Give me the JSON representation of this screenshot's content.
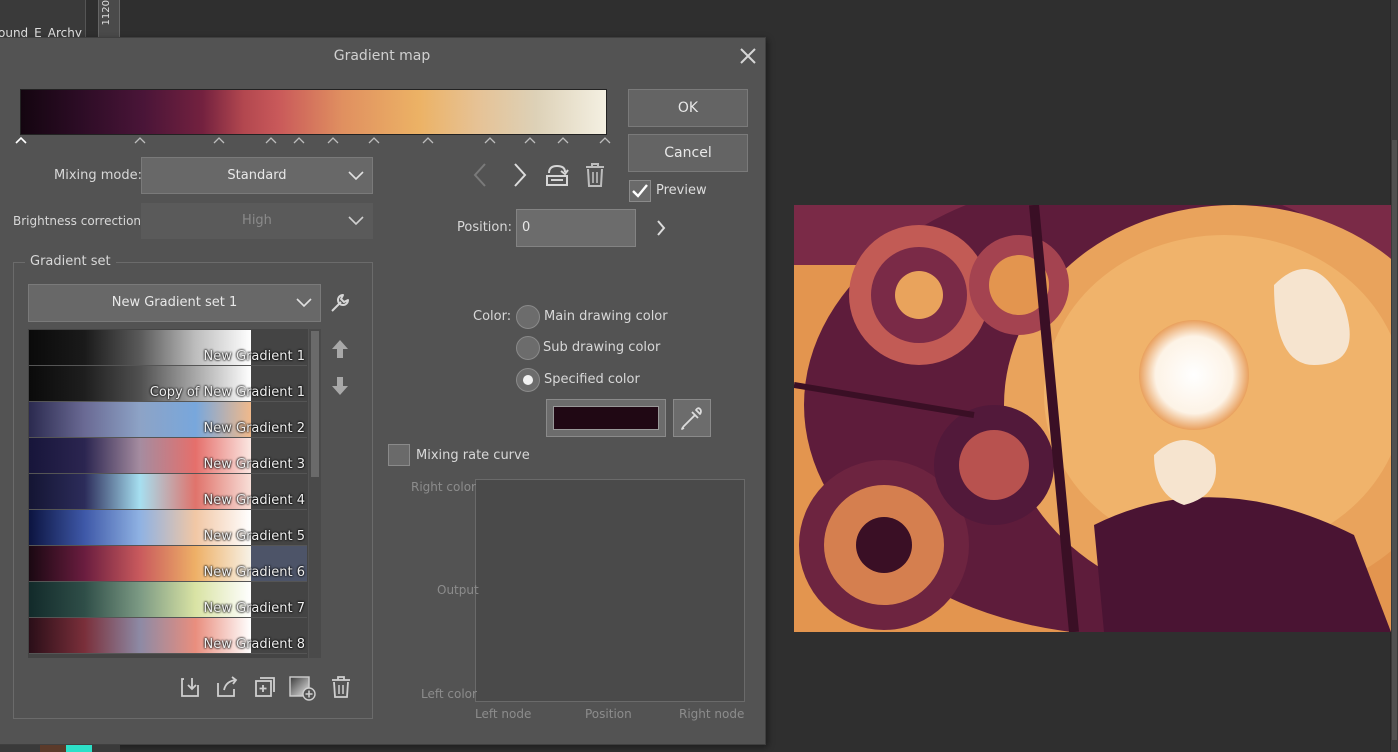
{
  "background": {
    "tab_label": "ound_E_Archy",
    "ruler_label": "1120"
  },
  "dialog": {
    "title": "Gradient map",
    "close_icon": "close-icon",
    "ok_label": "OK",
    "cancel_label": "Cancel",
    "preview_label": "Preview",
    "preview_checked": true,
    "mixing_mode_label": "Mixing mode:",
    "mixing_mode_value": "Standard",
    "brightness_label": "Brightness correction(L):",
    "brightness_value": "High",
    "position_label": "Position:",
    "position_value": "0",
    "gradient_set_label": "Gradient set",
    "gradient_set_value": "New Gradient set 1",
    "color_label": "Color:",
    "color_options": [
      "Main drawing color",
      "Sub drawing color",
      "Specified color"
    ],
    "color_selected": "Specified color",
    "specified_color": "#200814",
    "mixing_rate_label": "Mixing rate curve",
    "curve": {
      "right_color": "Right color",
      "output": "Output",
      "left_color": "Left color",
      "left_node": "Left node",
      "position": "Position",
      "right_node": "Right node"
    }
  },
  "gradients": [
    {
      "name": "New Gradient 1",
      "colors": [
        "#0a0a0a",
        "#1a1a1a",
        "#5a5a5a",
        "#bdbdbd",
        "#ffffff"
      ]
    },
    {
      "name": "Copy of New Gradient 1",
      "colors": [
        "#0a0a0a",
        "#1e1e1e",
        "#505050",
        "#a8a8a8",
        "#ffffff"
      ]
    },
    {
      "name": "New Gradient 2",
      "colors": [
        "#2b2a4f",
        "#6a6a94",
        "#8da3c6",
        "#78a7dc",
        "#f0b98b"
      ]
    },
    {
      "name": "New Gradient 3",
      "colors": [
        "#17153a",
        "#2b2550",
        "#a58ca0",
        "#e56f6b",
        "#fbe7e2"
      ]
    },
    {
      "name": "New Gradient 4",
      "colors": [
        "#141533",
        "#2c2c5a",
        "#a6dff0",
        "#e0736b",
        "#f8dfd8"
      ]
    },
    {
      "name": "New Gradient 5",
      "colors": [
        "#0c1440",
        "#3e58a8",
        "#8fb2e3",
        "#f1c7a5",
        "#ffffff"
      ]
    },
    {
      "name": "New Gradient 6",
      "colors": [
        "#1a0812",
        "#6a1d3f",
        "#c95a5d",
        "#eeb067",
        "#f7f2e7"
      ]
    },
    {
      "name": "New Gradient 7",
      "colors": [
        "#122a2a",
        "#2f4e48",
        "#7c9a84",
        "#d9e3a4",
        "#ffffff"
      ]
    },
    {
      "name": "New Gradient 8",
      "colors": [
        "#2a0e18",
        "#7a2f3a",
        "#8d8aa5",
        "#e98e7e",
        "#ffffff"
      ]
    }
  ],
  "icons": {
    "prev": "chevron-left-icon",
    "next": "chevron-right-icon",
    "reverse": "reverse-icon",
    "delete": "trash-icon",
    "wrench": "wrench-icon",
    "eyedropper": "eyedropper-icon",
    "up": "arrow-up-icon",
    "down": "arrow-down-icon"
  }
}
